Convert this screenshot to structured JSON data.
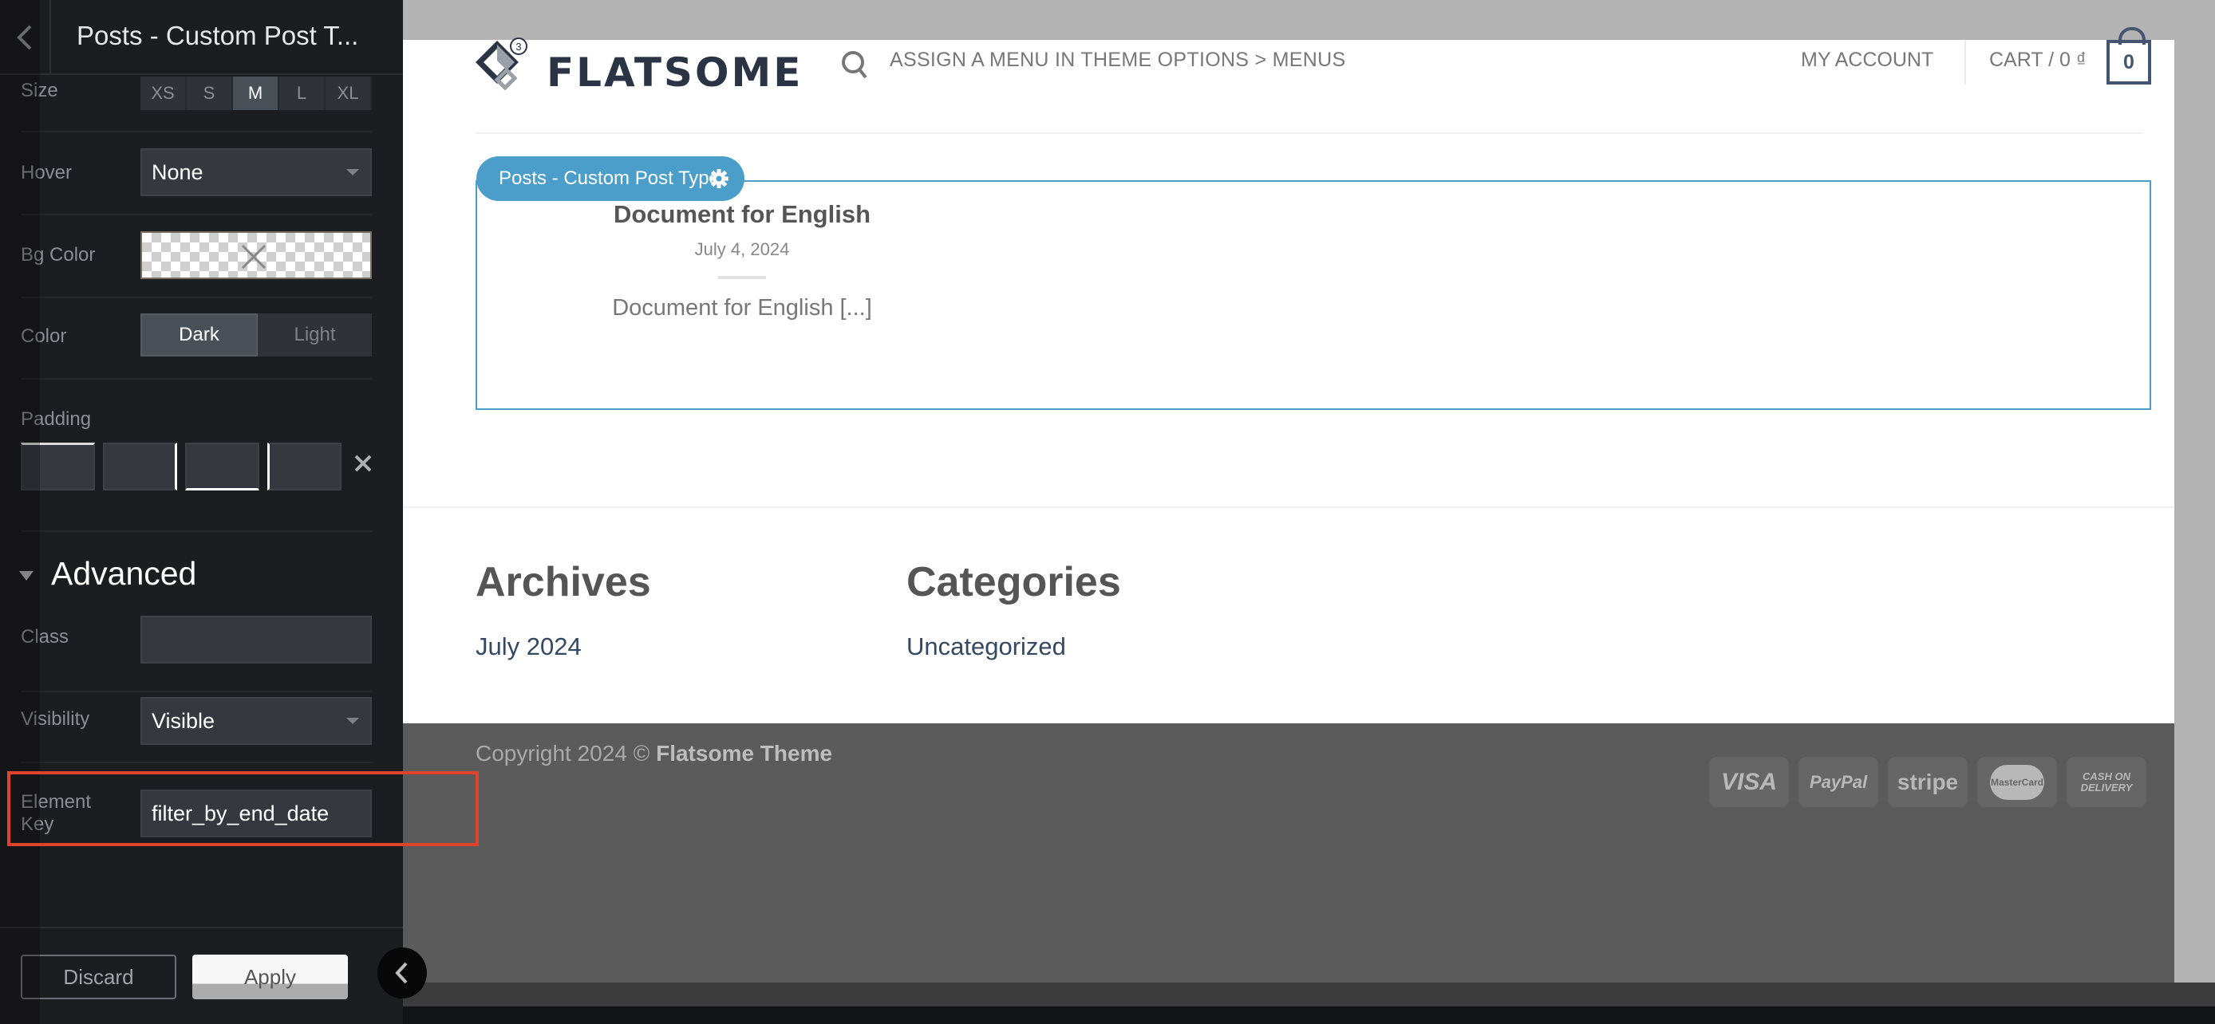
{
  "sidebar": {
    "title": "Posts - Custom Post T...",
    "back_icon": "chevron-left-icon",
    "size": {
      "label": "Size",
      "options": [
        "XS",
        "S",
        "M",
        "L",
        "XL"
      ],
      "selected": "M"
    },
    "hover": {
      "label": "Hover",
      "value": "None"
    },
    "bg_color": {
      "label": "Bg Color",
      "value": "transparent"
    },
    "color": {
      "label": "Color",
      "options": [
        "Dark",
        "Light"
      ],
      "selected": "Dark"
    },
    "padding": {
      "label": "Padding",
      "values": [
        "",
        "",
        "",
        ""
      ]
    },
    "advanced": {
      "title": "Advanced",
      "class": {
        "label": "Class",
        "value": ""
      },
      "visibility": {
        "label": "Visibility",
        "value": "Visible"
      },
      "element_key": {
        "label_line1": "Element",
        "label_line2": "Key",
        "value": "filter_by_end_date"
      }
    },
    "discard_label": "Discard",
    "apply_label": "Apply"
  },
  "site": {
    "logo_text": "FLATSOME",
    "logo_badge": "3",
    "nav_message": "ASSIGN A MENU IN THEME OPTIONS > MENUS",
    "my_account": "MY ACCOUNT",
    "cart_label": "CART / 0 ₫",
    "cart_count": "0",
    "element_tag": "Posts - Custom Post Type",
    "post": {
      "title": "Document for English",
      "date": "July 4, 2024",
      "excerpt": "Document for English [...]"
    },
    "widgets": [
      {
        "title": "Archives",
        "link": "July 2024"
      },
      {
        "title": "Categories",
        "link": "Uncategorized"
      }
    ],
    "footer": {
      "copyright_prefix": "Copyright 2024 © ",
      "copyright_brand": "Flatsome Theme",
      "payments": [
        "VISA",
        "PayPal",
        "stripe",
        "MasterCard",
        "CASH ON DELIVERY"
      ]
    }
  },
  "colors": {
    "accent": "#4a9ec9",
    "highlight": "#e0432b",
    "brand": "#2a3445"
  }
}
